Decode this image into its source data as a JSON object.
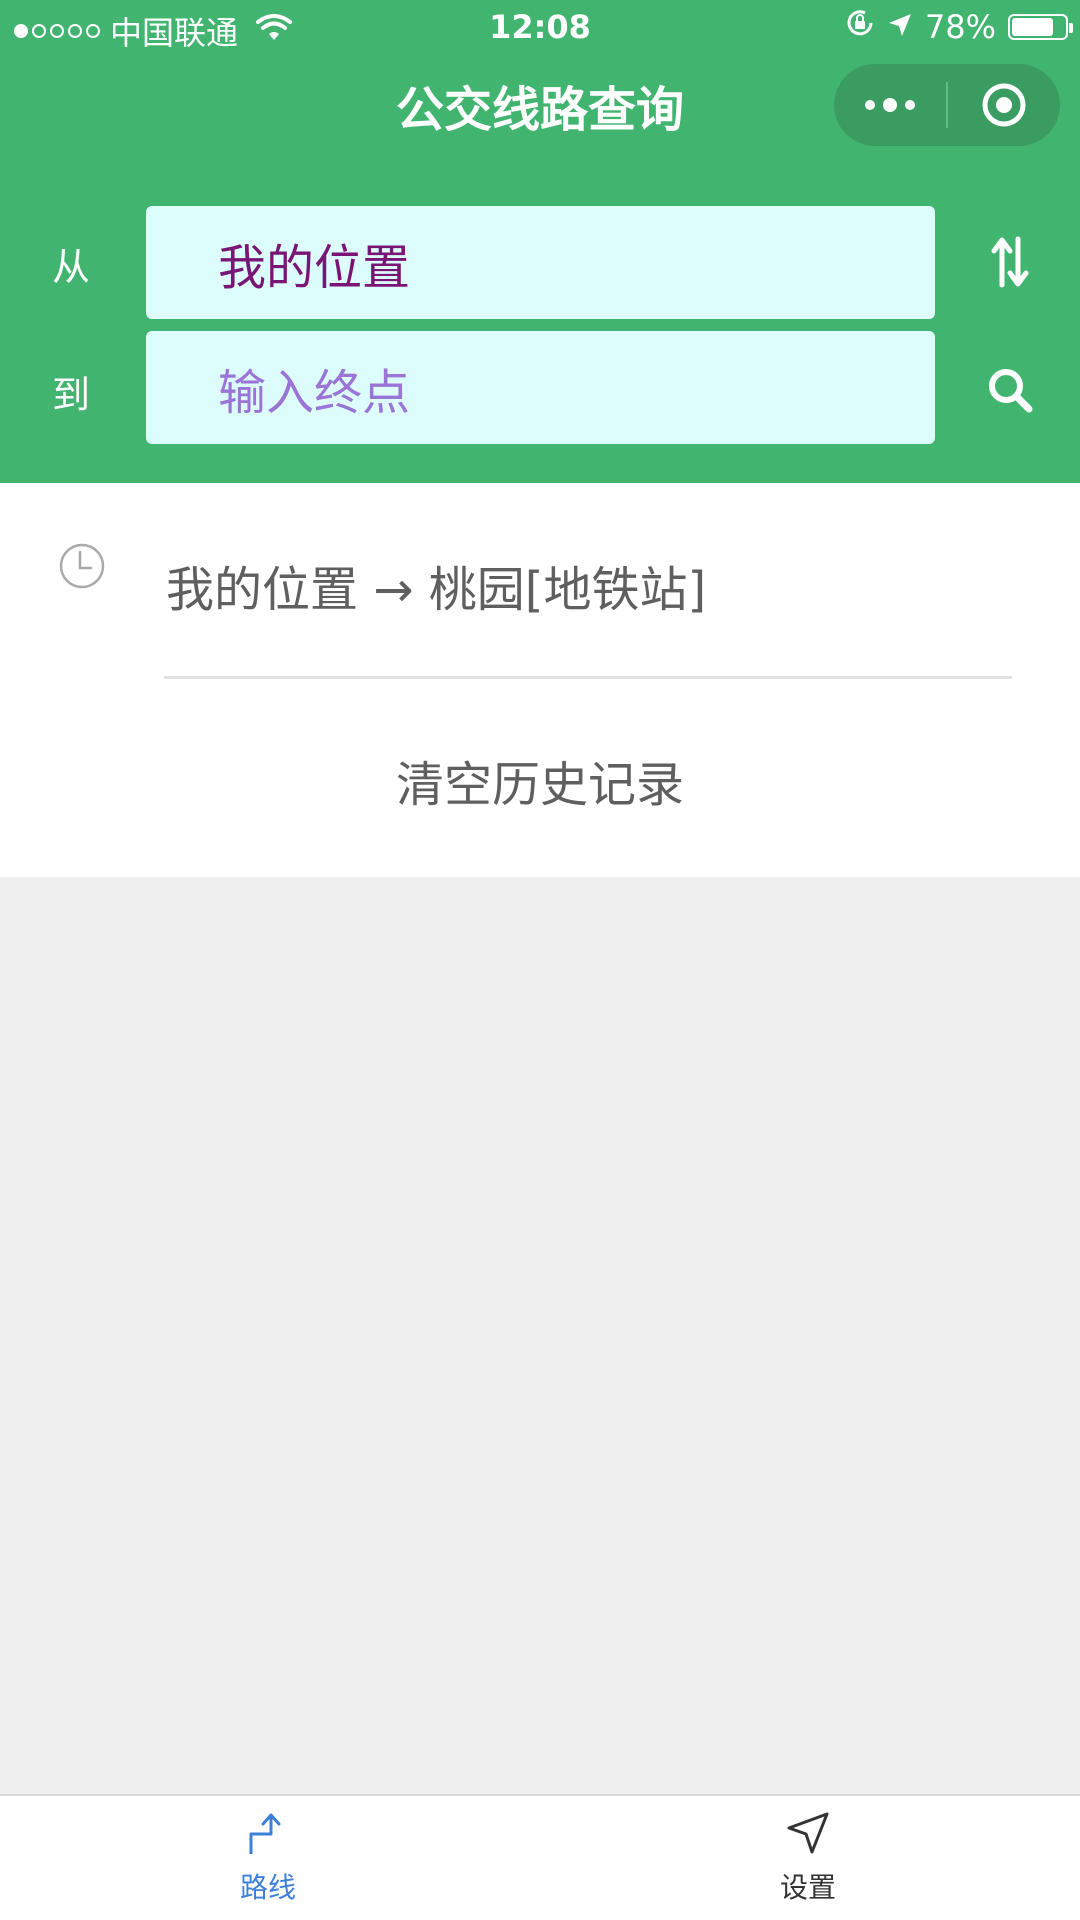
{
  "status_bar": {
    "carrier": "中国联通",
    "time": "12:08",
    "battery": "78%",
    "battery_level": 0.78,
    "signal_bars_filled": 1,
    "signal_bars_total": 5
  },
  "nav": {
    "title": "公交线路查询",
    "more_icon": "more-dots-icon",
    "close_icon": "target-icon"
  },
  "route": {
    "from_label": "从",
    "to_label": "到",
    "from_value": "我的位置",
    "to_placeholder": "输入终点",
    "swap_icon": "swap-arrows-icon",
    "search_icon": "search-icon"
  },
  "history": {
    "items": [
      {
        "text": "我的位置 → 桃园[地铁站]"
      }
    ],
    "clear_label": "清空历史记录"
  },
  "tabbar": {
    "tabs": [
      {
        "label": "路线",
        "icon": "route-icon",
        "active": true
      },
      {
        "label": "设置",
        "icon": "navigation-icon",
        "active": false
      }
    ]
  },
  "colors": {
    "brand_green": "#41b570",
    "input_bg": "#dcfdfb",
    "active_tab": "#3d80d9"
  }
}
